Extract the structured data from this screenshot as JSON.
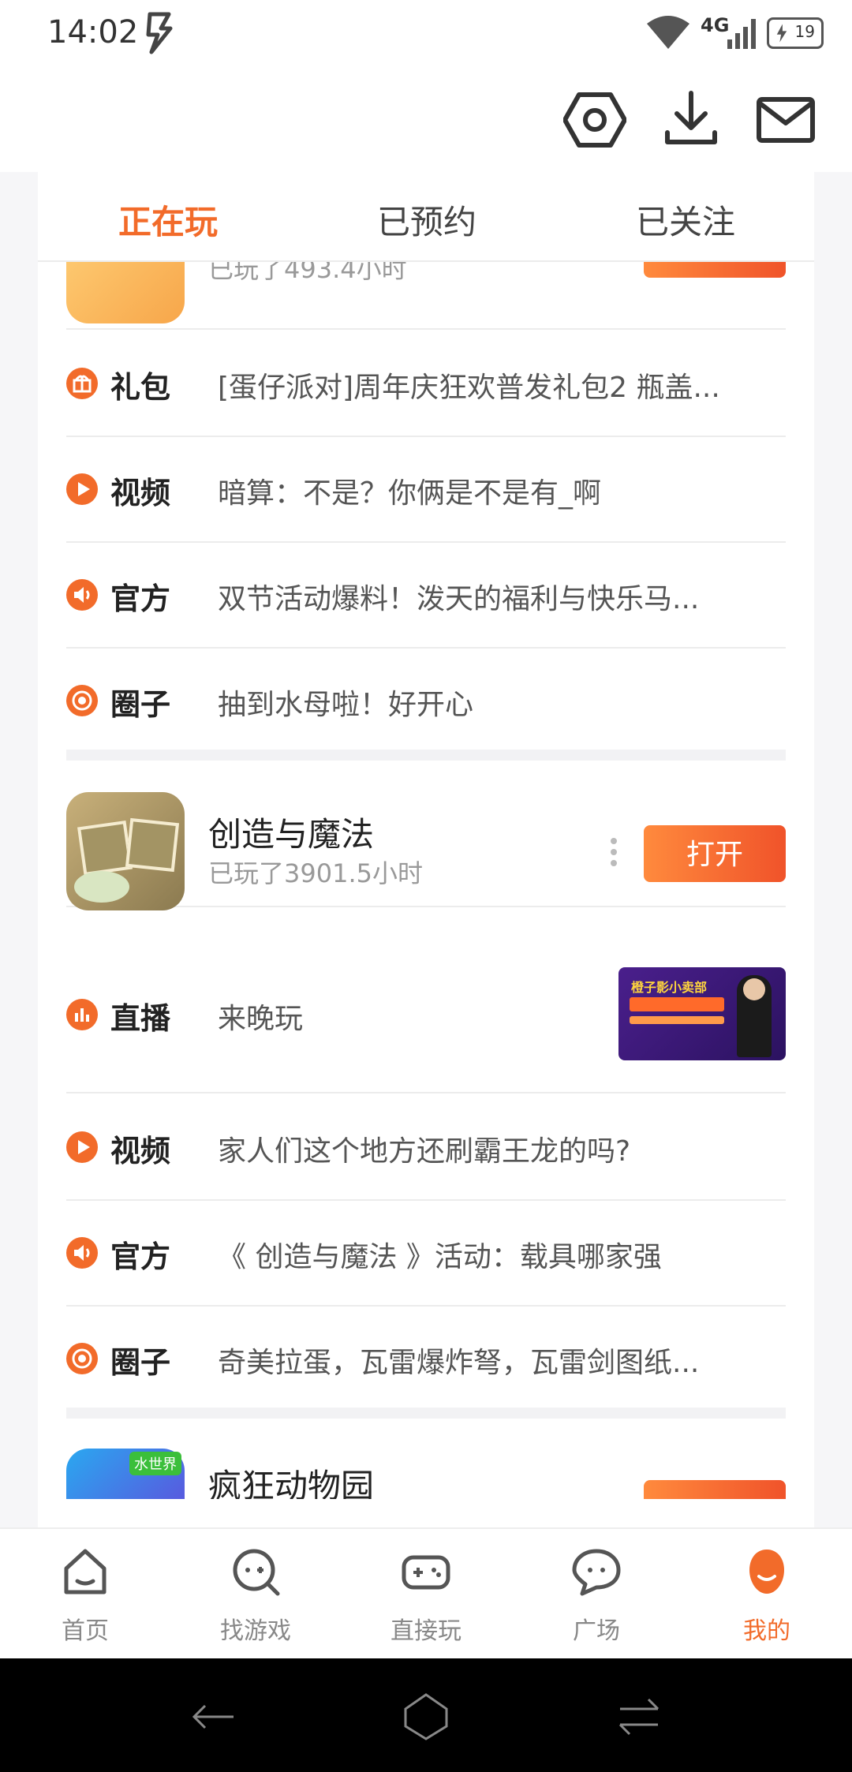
{
  "status": {
    "time": "14:02",
    "network": "4G",
    "battery": "19"
  },
  "tabs": [
    {
      "label": "正在玩"
    },
    {
      "label": "已预约"
    },
    {
      "label": "已关注"
    }
  ],
  "game1": {
    "played": "已玩了493.4小时",
    "rows": [
      {
        "label": "礼包",
        "text": "[蛋仔派对]周年庆狂欢普发礼包2 瓶盖...",
        "icon": "gift-icon"
      },
      {
        "label": "视频",
        "text": "暗算：不是？你俩是不是有_啊",
        "icon": "play-icon"
      },
      {
        "label": "官方",
        "text": "双节活动爆料！泼天的福利与快乐马...",
        "icon": "speaker-icon"
      },
      {
        "label": "圈子",
        "text": "抽到水母啦！好开心",
        "icon": "circle-icon"
      }
    ]
  },
  "game2": {
    "name": "创造与魔法",
    "played": "已玩了3901.5小时",
    "open_label": "打开",
    "live": {
      "label": "直播",
      "text": "来晚玩",
      "thumb_text": "橙子影小卖部"
    },
    "rows": [
      {
        "label": "视频",
        "text": "家人们这个地方还刷霸王龙的吗?",
        "icon": "play-icon"
      },
      {
        "label": "官方",
        "text": "《 创造与魔法 》活动：载具哪家强",
        "icon": "speaker-icon"
      },
      {
        "label": "圈子",
        "text": "奇美拉蛋，瓦雷爆炸弩，瓦雷剑图纸...",
        "icon": "circle-icon"
      }
    ]
  },
  "game3": {
    "name": "疯狂动物园",
    "badge": "水世界"
  },
  "bottom_nav": [
    {
      "label": "首页",
      "icon": "home-icon"
    },
    {
      "label": "找游戏",
      "icon": "find-game-icon"
    },
    {
      "label": "直接玩",
      "icon": "gamepad-icon"
    },
    {
      "label": "广场",
      "icon": "chat-icon"
    },
    {
      "label": "我的",
      "icon": "profile-icon"
    }
  ],
  "colors": {
    "accent": "#f26b2a",
    "button_start": "#ff8a3d",
    "button_end": "#f0532a"
  }
}
